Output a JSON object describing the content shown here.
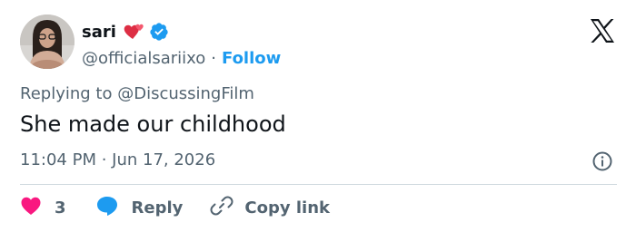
{
  "author": {
    "name": "sari",
    "handle": "@officialsariixo",
    "separator": "·",
    "follow_label": "Follow"
  },
  "reply_to": {
    "prefix": "Replying to",
    "handle": "@DiscussingFilm"
  },
  "tweet": {
    "text": "She made our childhood",
    "timestamp": "11:04 PM · Jun 17, 2026"
  },
  "actions": {
    "like_count": "3",
    "reply_label": "Reply",
    "copy_link_label": "Copy link"
  },
  "colors": {
    "accent": "#1d9bf0",
    "like": "#f91880",
    "text": "#0f1419",
    "secondary": "#536471",
    "divider": "#cfd9de"
  },
  "icons": [
    "hearts-emoji-icon",
    "verified-badge-icon",
    "x-logo-icon",
    "info-icon",
    "heart-icon",
    "reply-bubble-icon",
    "link-icon"
  ]
}
